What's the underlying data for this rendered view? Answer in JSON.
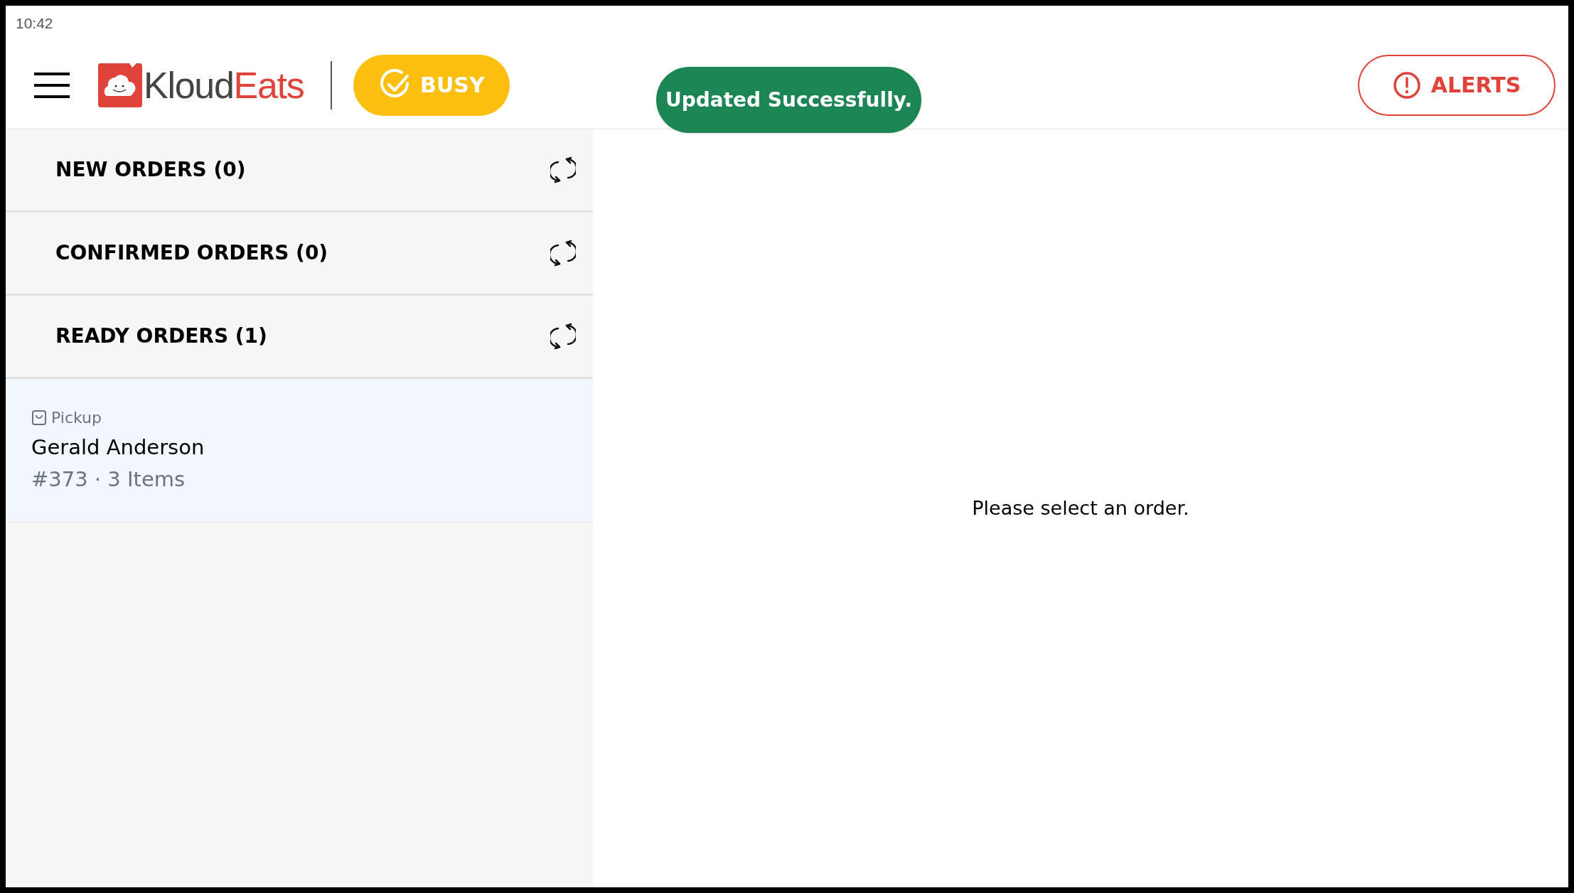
{
  "status_bar": {
    "time": "10:42"
  },
  "header": {
    "logo": {
      "part_1": "Kloud",
      "part_2": "Eats"
    },
    "busy_button": {
      "label": "BUSY",
      "on": true
    },
    "alerts_button": {
      "label": "ALERTS"
    }
  },
  "toast": {
    "text": "Updated Successfully."
  },
  "sections": [
    {
      "title": "NEW ORDERS (0)"
    },
    {
      "title": "CONFIRMED ORDERS (0)"
    },
    {
      "title": "READY ORDERS (1)"
    }
  ],
  "orders": [
    {
      "type": "Pickup",
      "customer": "Gerald Anderson",
      "summary": "#373 · 3 Items",
      "selected": true
    }
  ],
  "detail": {
    "empty_message": "Please select an order."
  }
}
